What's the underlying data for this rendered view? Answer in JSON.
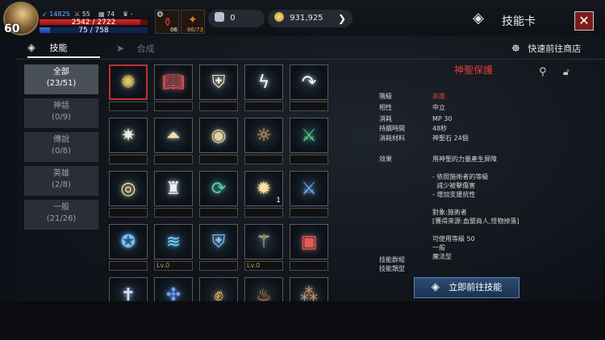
{
  "player": {
    "level": "60",
    "power": "14825",
    "stat2": "55",
    "stat3": "74",
    "stat4": "-",
    "hp": "2542 / 2722",
    "hp_fraction": 0.934,
    "mp": "75 / 758",
    "mp_fraction": 0.099
  },
  "quick_slots": [
    {
      "icon": "potion-icon",
      "count": "06"
    },
    {
      "icon": "scroll-icon",
      "count": "86/73"
    }
  ],
  "currency": {
    "gem_value": "0",
    "gold_value": "931,925"
  },
  "window": {
    "title": "技能卡",
    "close": "✕"
  },
  "tabs": [
    {
      "label": "技能",
      "active": true
    },
    {
      "label": "合成",
      "active": false
    }
  ],
  "shop_link": "快速前往商店",
  "categories": [
    {
      "name": "全部",
      "count": "(23/51)",
      "active": true
    },
    {
      "name": "神話",
      "count": "(0/9)",
      "active": false
    },
    {
      "name": "傳說",
      "count": "(0/8)",
      "active": false
    },
    {
      "name": "英雄",
      "count": "(2/8)",
      "active": false
    },
    {
      "name": "一般",
      "count": "(21/26)",
      "active": false
    }
  ],
  "cards": [
    {
      "icon": "shield-burst-icon",
      "label": "",
      "count": "",
      "selected": true
    },
    {
      "icon": "holy-book-icon",
      "label": "",
      "count": "",
      "selected": false
    },
    {
      "icon": "shield-icon",
      "label": "",
      "count": "",
      "selected": false
    },
    {
      "icon": "lightning-icon",
      "label": "",
      "count": "",
      "selected": false
    },
    {
      "icon": "curved-arrow-icon",
      "label": "",
      "count": "",
      "selected": false
    },
    {
      "icon": "starburst-icon",
      "label": "",
      "count": "",
      "selected": false
    },
    {
      "icon": "pyramid-icon",
      "label": "",
      "count": "",
      "selected": false
    },
    {
      "icon": "eye-icon",
      "label": "",
      "count": "",
      "selected": false
    },
    {
      "icon": "sun-face-icon",
      "label": "",
      "count": "",
      "selected": false
    },
    {
      "icon": "green-sword-icon",
      "label": "",
      "count": "",
      "selected": false
    },
    {
      "icon": "orb-icon",
      "label": "",
      "count": "",
      "selected": false
    },
    {
      "icon": "helmet-icon",
      "label": "",
      "count": "",
      "selected": false
    },
    {
      "icon": "cycle-arrows-icon",
      "label": "",
      "count": "",
      "selected": false
    },
    {
      "icon": "fire-burst-icon",
      "label": "",
      "count": "1",
      "selected": false
    },
    {
      "icon": "ice-sword-icon",
      "label": "",
      "count": "",
      "selected": false
    },
    {
      "icon": "star-shield-icon",
      "label": "",
      "count": "",
      "selected": false
    },
    {
      "icon": "tornado-icon",
      "label": "Lv.0",
      "count": "",
      "selected": false
    },
    {
      "icon": "cross-shield-icon",
      "label": "",
      "count": "",
      "selected": false
    },
    {
      "icon": "sword-glow-icon",
      "label": "Lv.0",
      "count": "",
      "selected": false
    },
    {
      "icon": "red-book-icon",
      "label": "",
      "count": "",
      "selected": false
    },
    {
      "icon": "cross-icon",
      "label": "",
      "count": "",
      "selected": false
    },
    {
      "icon": "swirl-icon",
      "label": "",
      "count": "",
      "selected": false
    },
    {
      "icon": "fist-icon",
      "label": "",
      "count": "",
      "selected": false
    },
    {
      "icon": "flame-icon",
      "label": "",
      "count": "",
      "selected": false
    },
    {
      "icon": "dust-icon",
      "label": "",
      "count": "",
      "selected": false
    }
  ],
  "detail": {
    "name": "神聖保護",
    "rows": [
      {
        "k": "階級",
        "v": "英雄",
        "color": "#e03c3c"
      },
      {
        "k": "相性",
        "v": "中立",
        "color": ""
      },
      {
        "k": "消耗",
        "v": "MP 30",
        "color": ""
      },
      {
        "k": "持續時間",
        "v": "48秒",
        "color": ""
      },
      {
        "k": "消耗材料",
        "v": "神聖石 24個",
        "color": ""
      }
    ],
    "effect_label": "效果",
    "effect_lines": [
      "用神聖的力量產生屏障",
      "",
      "- 依照施術者的等級",
      "  減少被擊傷害",
      "- 增加支援抗性",
      "",
      "對象:施術者",
      "[獲得來源:血盟商人,怪物掉落]",
      "",
      "可使用等級 50",
      "一般",
      "魔法型"
    ],
    "group_label": "技能群組",
    "type_label": "技能類型",
    "goto_button": "立即前往技能"
  },
  "colors": {
    "accent_red": "#e03c3c",
    "button_blue": "#2d4d74"
  }
}
